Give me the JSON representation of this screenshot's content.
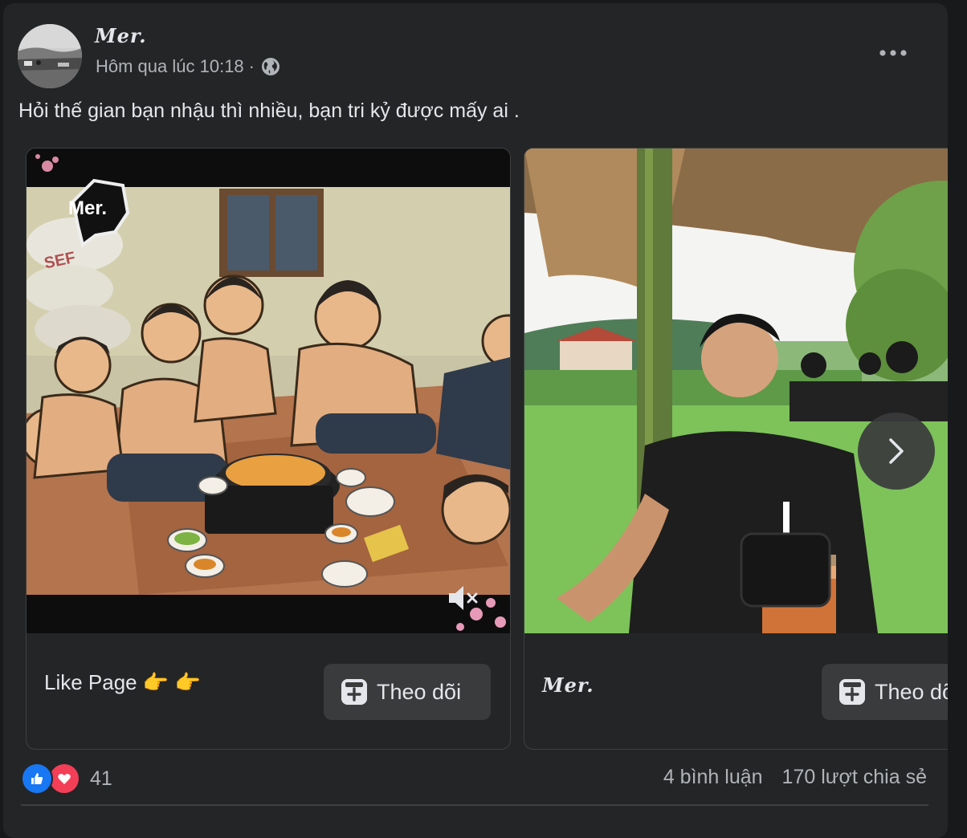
{
  "post": {
    "author": "Mer.",
    "timestamp": "Hôm qua lúc 10:18",
    "separator": "·",
    "audience_icon": "globe-icon",
    "caption": "Hỏi thế gian bạn nhậu thì nhiều, bạn tri kỷ được mấy ai ."
  },
  "cards": [
    {
      "watermark": "Mer.",
      "bag_text": "SEF",
      "footer_text": "Like Page 👉 👉",
      "button_label": "Theo dõi"
    },
    {
      "footer_text": "Mer.",
      "button_label": "Theo dõi"
    }
  ],
  "stats": {
    "reaction_count": "41",
    "comments": "4 bình luận",
    "shares": "170 lượt chia sẻ"
  },
  "colors": {
    "background": "#18191a",
    "card": "#242526",
    "button": "#3a3b3c",
    "like": "#1877f2",
    "love": "#f33e58"
  }
}
